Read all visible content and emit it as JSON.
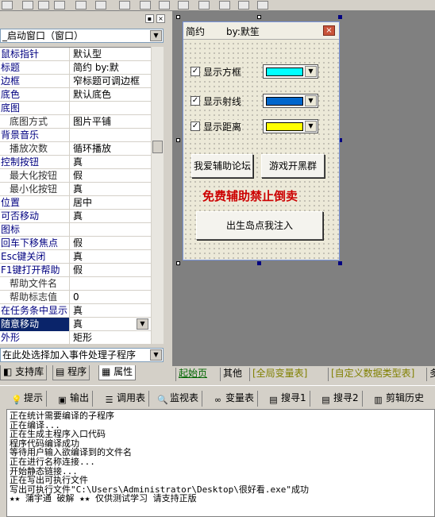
{
  "combo_value": "_启动窗口（窗口）",
  "properties": [
    {
      "name": "鼠标指针",
      "value": "默认型",
      "sub": false
    },
    {
      "name": "标题",
      "value": "简约        by:默",
      "sub": false
    },
    {
      "name": "边框",
      "value": "窄标题可调边框",
      "sub": false
    },
    {
      "name": "底色",
      "value": "默认底色",
      "sub": false
    },
    {
      "name": "底图",
      "value": "",
      "sub": false
    },
    {
      "name": "底图方式",
      "value": "图片平铺",
      "sub": true
    },
    {
      "name": "背景音乐",
      "value": "",
      "sub": false
    },
    {
      "name": "播放次数",
      "value": "循环播放",
      "sub": true
    },
    {
      "name": "控制按钮",
      "value": "真",
      "sub": false
    },
    {
      "name": "最大化按钮",
      "value": "假",
      "sub": true
    },
    {
      "name": "最小化按钮",
      "value": "真",
      "sub": true
    },
    {
      "name": "位置",
      "value": "居中",
      "sub": false
    },
    {
      "name": "可否移动",
      "value": "真",
      "sub": false
    },
    {
      "name": "图标",
      "value": "",
      "sub": false
    },
    {
      "name": "回车下移焦点",
      "value": "假",
      "sub": false
    },
    {
      "name": "Esc键关闭",
      "value": "真",
      "sub": false
    },
    {
      "name": "F1键打开帮助",
      "value": "假",
      "sub": false
    },
    {
      "name": "帮助文件名",
      "value": "",
      "sub": true
    },
    {
      "name": "帮助标志值",
      "value": "0",
      "sub": true
    },
    {
      "name": "在任务条中显示",
      "value": "真",
      "sub": false
    },
    {
      "name": "随意移动",
      "value": "真",
      "sub": false,
      "selected": true
    },
    {
      "name": "外形",
      "value": "矩形",
      "sub": false
    }
  ],
  "event_combo": "在此处选择加入事件处理子程序",
  "left_tabs": [
    "支持库",
    "程序",
    "属性"
  ],
  "form": {
    "title": "简约",
    "author": "by:默笙",
    "close_glyph": "×",
    "checkboxes": [
      {
        "label": "显示方框",
        "checked": true,
        "color": "#00ffff"
      },
      {
        "label": "显示射线",
        "checked": true,
        "color": "#0066cc"
      },
      {
        "label": "显示距离",
        "checked": true,
        "color": "#ffff00"
      }
    ],
    "btn_forum": "我爱辅助论坛",
    "btn_group": "游戏开黑群",
    "red_notice": "免费辅助禁止倒卖",
    "btn_inject": "出生岛点我注入"
  },
  "page_tabs": [
    "起始页",
    "其他",
    "[全局变量表]",
    "[自定义数据类型表]",
    "多"
  ],
  "output_tabs": [
    "提示",
    "输出",
    "调用表",
    "监视表",
    "变量表",
    "搜寻1",
    "搜寻2",
    "剪辑历史"
  ],
  "output_lines": [
    "正在统计需要编译的子程序",
    "正在编译...",
    "正在生成主程序入口代码",
    "程序代码编译成功",
    "等待用户输入欲编译到的文件名",
    "正在进行名称连接...",
    "开始静态链接...",
    "正在写出可执行文件",
    "写出可执行文件\"C:\\Users\\Administrator\\Desktop\\很好看.exe\"成功",
    "★★ 蒲宇通 破解 ★★ 仅供测试学习 请支持正版"
  ]
}
